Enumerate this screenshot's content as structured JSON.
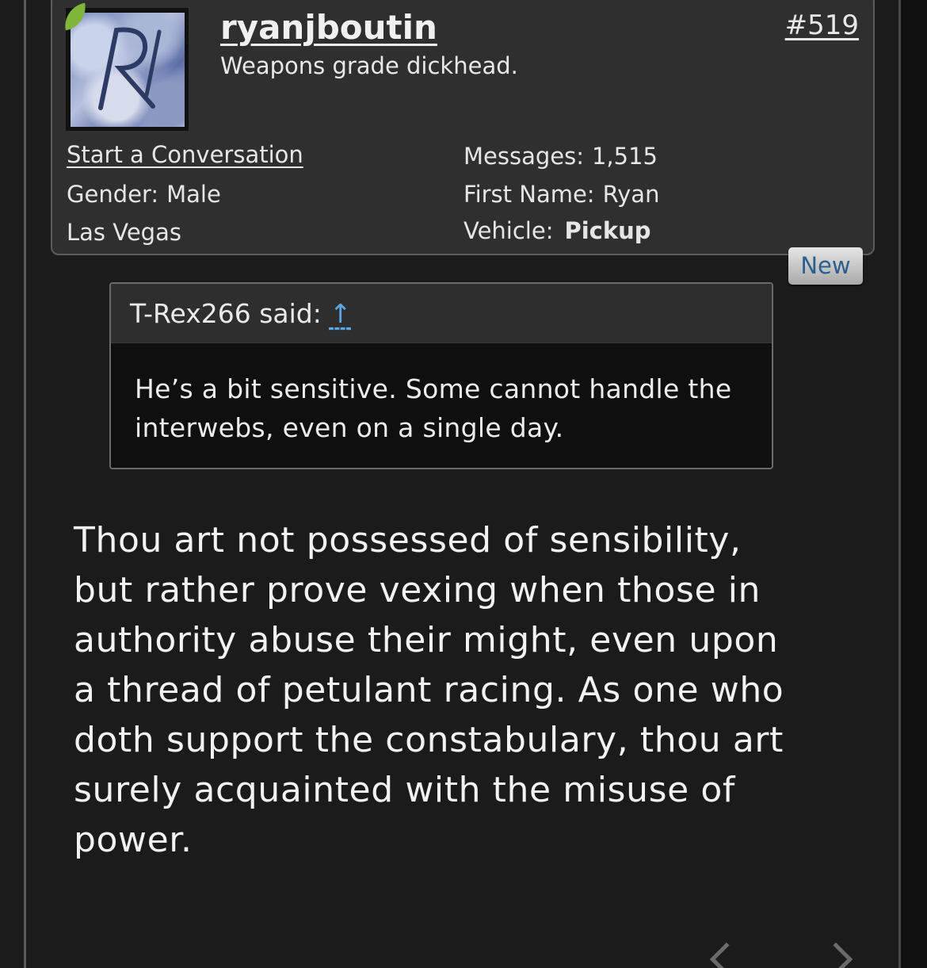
{
  "user": {
    "username": "ryanjboutin",
    "title": "Weapons grade dickhead.",
    "post_number": "#519",
    "start_conversation": "Start a Conversation",
    "gender_label": "Gender:",
    "gender": "Male",
    "location": "Las Vegas",
    "messages_label": "Messages:",
    "messages": "1,515",
    "first_name_label": "First Name:",
    "first_name": "Ryan",
    "vehicle_label": "Vehicle:",
    "vehicle": "Pickup"
  },
  "badge": {
    "new_label": "New"
  },
  "quote": {
    "author_said": "T-Rex266 said:",
    "arrow": "↑",
    "text": "He’s a bit sensitive. Some cannot handle the interwebs, even on a single day."
  },
  "post": {
    "text": "Thou art not possessed of sensibility, but rather prove vexing when those in authority abuse their might, even upon a thread of petulant racing. As one who doth support the constabulary, thou art surely acquainted with the misuse of power."
  },
  "icons": {
    "online": "online-indicator-icon",
    "prev": "chevron-left-icon",
    "next": "chevron-right-icon"
  }
}
